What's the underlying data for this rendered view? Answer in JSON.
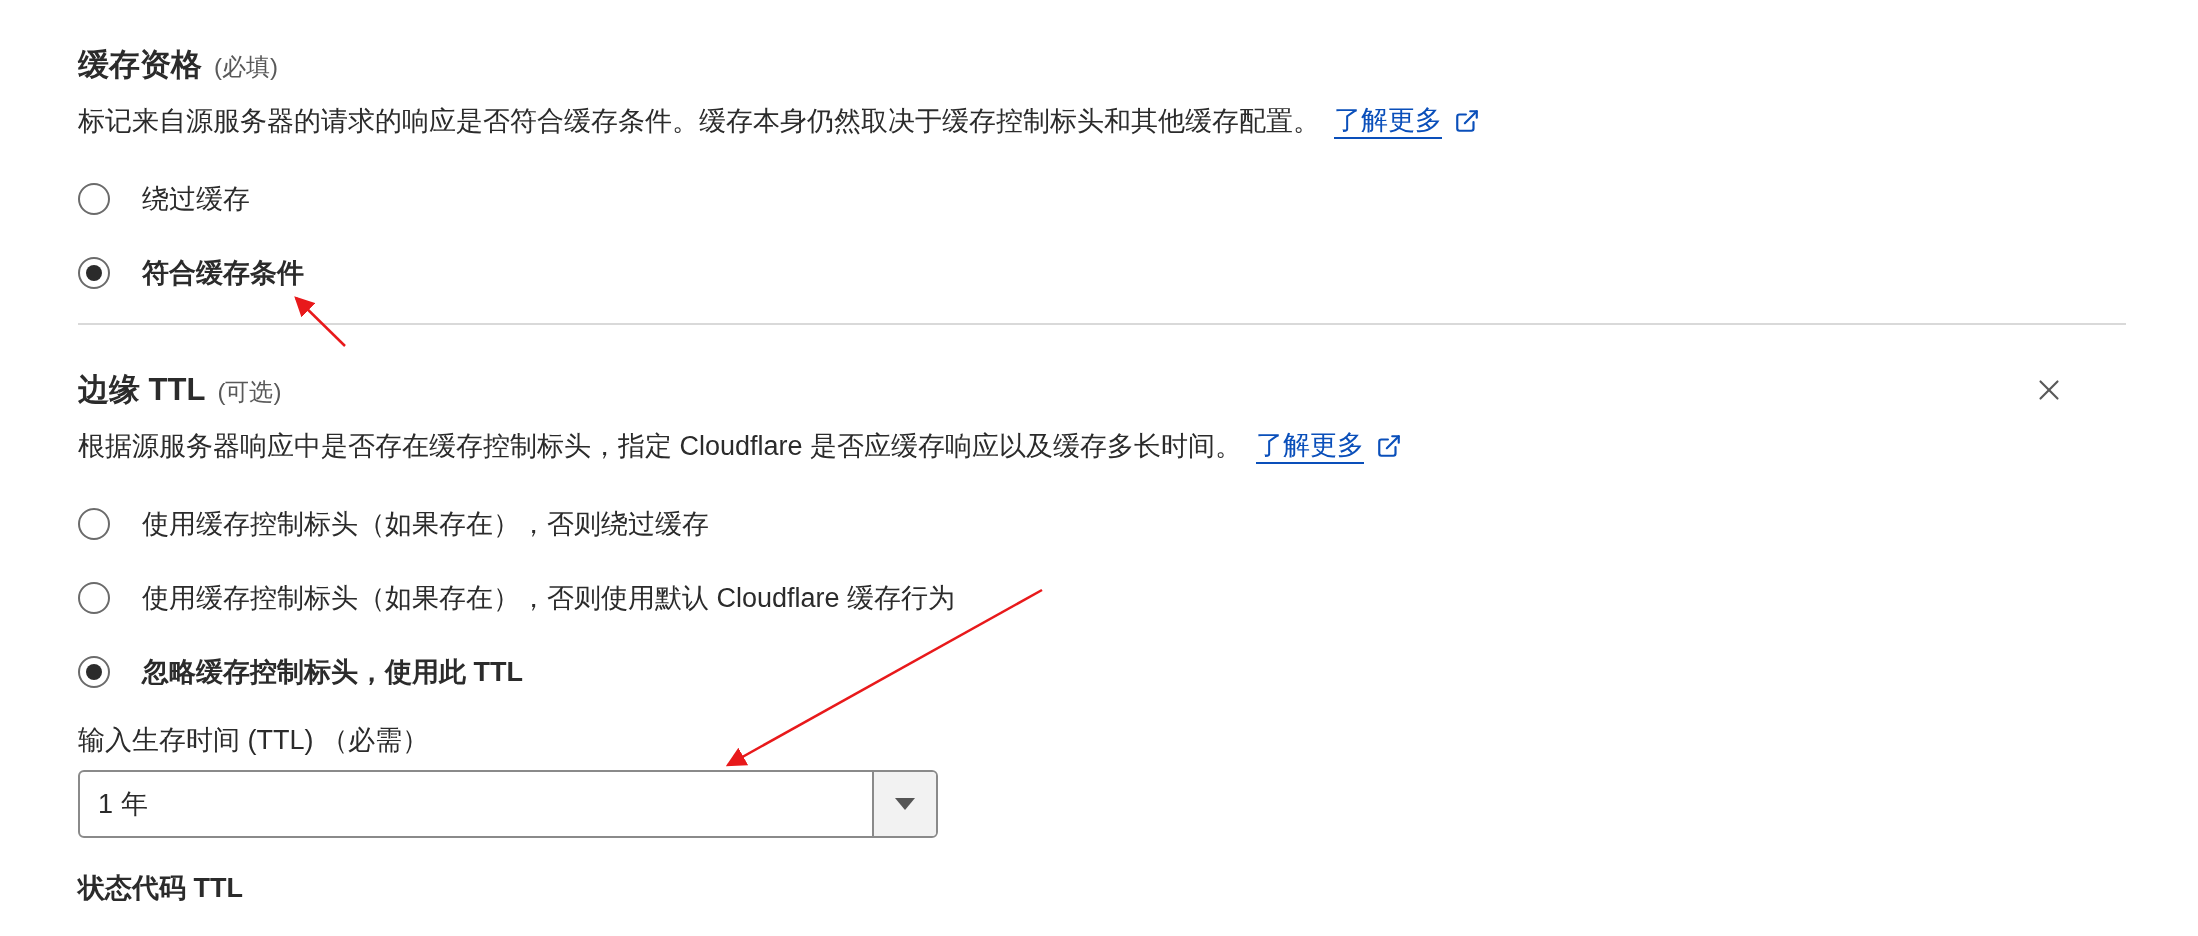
{
  "sections": [
    {
      "title": "缓存资格",
      "tag": "(必填)",
      "description": "标记来自源服务器的请求的响应是否符合缓存条件。缓存本身仍然取决于缓存控制标头和其他缓存配置。",
      "link": "了解更多",
      "closable": false,
      "options": [
        {
          "label": "绕过缓存",
          "selected": false
        },
        {
          "label": "符合缓存条件",
          "selected": true
        }
      ]
    },
    {
      "title": "边缘 TTL",
      "tag": "(可选)",
      "description": "根据源服务器响应中是否存在缓存控制标头，指定 Cloudflare 是否应缓存响应以及缓存多长时间。",
      "link": "了解更多",
      "closable": true,
      "options": [
        {
          "label": "使用缓存控制标头（如果存在），否则绕过缓存",
          "selected": false
        },
        {
          "label": "使用缓存控制标头（如果存在），否则使用默认 Cloudflare 缓存行为",
          "selected": false
        },
        {
          "label": "忽略缓存控制标头，使用此 TTL",
          "selected": true
        }
      ]
    }
  ],
  "ttl_field": {
    "label": "输入生存时间 (TTL) （必需）",
    "value": "1 年"
  },
  "status_code": {
    "title": "状态代码 TTL"
  }
}
